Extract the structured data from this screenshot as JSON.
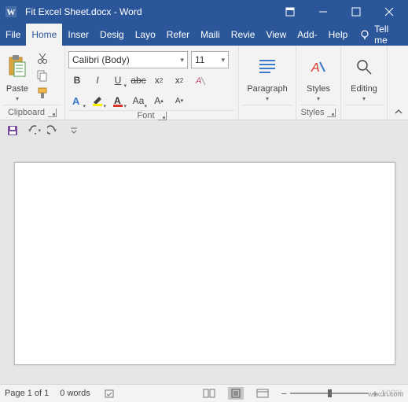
{
  "title": "Fit Excel Sheet.docx - Word",
  "tabs": {
    "file": "File",
    "home": "Home",
    "insert": "Inser",
    "design": "Desig",
    "layout": "Layo",
    "references": "Refer",
    "mailings": "Maili",
    "review": "Revie",
    "view": "View",
    "addins": "Add-",
    "help": "Help"
  },
  "tellme": "Tell me",
  "groups": {
    "clipboard": "Clipboard",
    "font": "Font",
    "paragraph": "Paragraph",
    "styles": "Styles",
    "editing": "Editing"
  },
  "paste": "Paste",
  "font": {
    "name": "Calibri (Body)",
    "size": "11"
  },
  "status": {
    "page": "Page 1 of 1",
    "words": "0 words",
    "zoom": "100%",
    "watermark": "wsxdn.com"
  }
}
